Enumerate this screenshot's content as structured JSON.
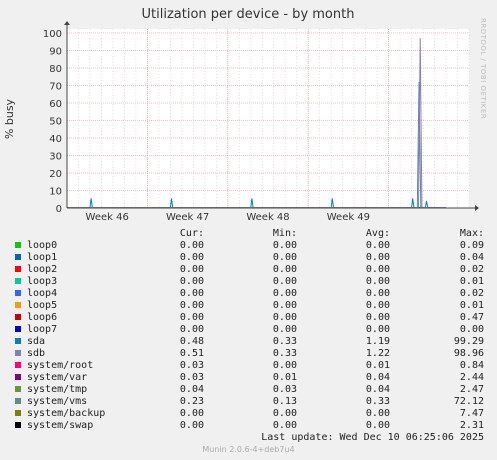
{
  "watermark": "RRDTOOL / TOBI OETIKER",
  "chart_data": {
    "type": "line",
    "title": "Utilization per device - by month",
    "ylabel": "% busy",
    "xlabel": "",
    "ylim": [
      0,
      100
    ],
    "y_ticks": [
      "0",
      "10",
      "20",
      "30",
      "40",
      "50",
      "60",
      "70",
      "80",
      "90",
      "100"
    ],
    "x_range": [
      0,
      35
    ],
    "week_labels": [
      {
        "label": "Week 46",
        "x": 7
      },
      {
        "label": "Week 47",
        "x": 14
      },
      {
        "label": "Week 48",
        "x": 21
      },
      {
        "label": "Week 49",
        "x": 28
      }
    ],
    "grid": true,
    "series": [
      {
        "name": "sda",
        "color": "#0080C0",
        "points": [
          [
            0,
            0.3
          ],
          [
            2.0,
            0.3
          ],
          [
            2.1,
            5.5
          ],
          [
            2.2,
            0.3
          ],
          [
            9.0,
            0.3
          ],
          [
            9.1,
            5.5
          ],
          [
            9.2,
            0.3
          ],
          [
            16.0,
            0.3
          ],
          [
            16.1,
            5.5
          ],
          [
            16.2,
            0.3
          ],
          [
            23.0,
            0.3
          ],
          [
            23.1,
            5.5
          ],
          [
            23.2,
            0.3
          ],
          [
            30.0,
            0.3
          ],
          [
            30.1,
            5.5
          ],
          [
            30.2,
            0.3
          ],
          [
            31.2,
            0.3
          ],
          [
            31.3,
            4.0
          ],
          [
            31.4,
            0.3
          ],
          [
            33.0,
            0.3
          ]
        ]
      },
      {
        "name": "system/vms",
        "color": "#5E8C8C",
        "points": [
          [
            0,
            0.2
          ],
          [
            30.5,
            0.2
          ],
          [
            30.65,
            72
          ],
          [
            30.8,
            0.2
          ],
          [
            33.0,
            0.2
          ]
        ]
      },
      {
        "name": "sdb",
        "color": "#8080C0",
        "points": [
          [
            0,
            0.3
          ],
          [
            30.6,
            0.3
          ],
          [
            30.75,
            97
          ],
          [
            30.9,
            0.3
          ],
          [
            33.0,
            0.3
          ]
        ]
      }
    ]
  },
  "legend": {
    "headers": {
      "cur": "Cur:",
      "min": "Min:",
      "avg": "Avg:",
      "max": "Max:"
    },
    "rows": [
      {
        "name": "loop0",
        "color": "#00CC00",
        "cur": "0.00",
        "min": "0.00",
        "avg": "0.00",
        "max": "0.09"
      },
      {
        "name": "loop1",
        "color": "#0066B3",
        "cur": "0.00",
        "min": "0.00",
        "avg": "0.00",
        "max": "0.04"
      },
      {
        "name": "loop2",
        "color": "#FF0000",
        "cur": "0.00",
        "min": "0.00",
        "avg": "0.00",
        "max": "0.02"
      },
      {
        "name": "loop3",
        "color": "#00CC99",
        "cur": "0.00",
        "min": "0.00",
        "avg": "0.00",
        "max": "0.01"
      },
      {
        "name": "loop4",
        "color": "#3366FF",
        "cur": "0.00",
        "min": "0.00",
        "avg": "0.00",
        "max": "0.02"
      },
      {
        "name": "loop5",
        "color": "#FF9900",
        "cur": "0.00",
        "min": "0.00",
        "avg": "0.00",
        "max": "0.01"
      },
      {
        "name": "loop6",
        "color": "#CC0000",
        "cur": "0.00",
        "min": "0.00",
        "avg": "0.00",
        "max": "0.47"
      },
      {
        "name": "loop7",
        "color": "#0000CC",
        "cur": "0.00",
        "min": "0.00",
        "avg": "0.00",
        "max": "0.00"
      },
      {
        "name": "sda",
        "color": "#0080C0",
        "cur": "0.48",
        "min": "0.33",
        "avg": "1.19",
        "max": "99.29"
      },
      {
        "name": "sdb",
        "color": "#8080C0",
        "cur": "0.51",
        "min": "0.33",
        "avg": "1.22",
        "max": "98.96"
      },
      {
        "name": "system/root",
        "color": "#FF0080",
        "cur": "0.03",
        "min": "0.00",
        "avg": "0.01",
        "max": "0.84"
      },
      {
        "name": "system/var",
        "color": "#800080",
        "cur": "0.03",
        "min": "0.01",
        "avg": "0.04",
        "max": "2.44"
      },
      {
        "name": "system/tmp",
        "color": "#669933",
        "cur": "0.04",
        "min": "0.03",
        "avg": "0.04",
        "max": "2.47"
      },
      {
        "name": "system/vms",
        "color": "#5E8C8C",
        "cur": "0.23",
        "min": "0.13",
        "avg": "0.33",
        "max": "72.12"
      },
      {
        "name": "system/backup",
        "color": "#808000",
        "cur": "0.00",
        "min": "0.00",
        "avg": "0.00",
        "max": "7.47"
      },
      {
        "name": "system/swap",
        "color": "#000000",
        "cur": "0.00",
        "min": "0.00",
        "avg": "0.00",
        "max": "2.31"
      }
    ]
  },
  "footer": {
    "last_update": "Last update:  Wed Dec 10 06:25:06 2025",
    "munin_version": "Munin 2.0.6-4+deb7u4"
  }
}
